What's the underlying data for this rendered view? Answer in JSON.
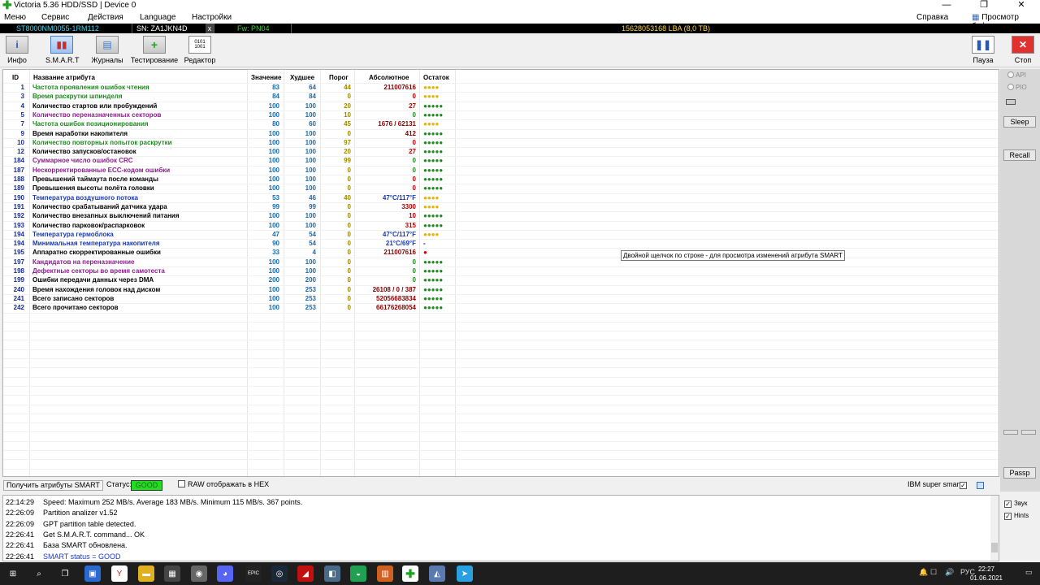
{
  "window": {
    "title": "Victoria 5.36 HDD/SSD | Device 0",
    "min": "—",
    "max": "❐",
    "close": "✕"
  },
  "menu": {
    "items": [
      "Меню",
      "Сервис",
      "Действия",
      "Language",
      "Настройки"
    ],
    "help": "Справка",
    "buffer": "Просмотр буфера"
  },
  "device": {
    "model": "ST8000NM0055-1RM112",
    "serial": "SN: ZA1JKN4D",
    "close": "x",
    "firmware": "Fw: PN04",
    "lba": "15628053168 LBA (8,0 TB)"
  },
  "toolbar": {
    "info": "Инфо",
    "smart": "S.M.A.R.T",
    "logs": "Журналы",
    "test": "Тестирование",
    "editor": "Редактор",
    "pause": "Пауза",
    "stop": "Стоп"
  },
  "table": {
    "headers": {
      "id": "ID",
      "name": "Название атрибута",
      "value": "Значение",
      "worst": "Худшее",
      "threshold": "Порог",
      "raw": "Абсолютное",
      "remaining": "Остаток"
    },
    "rows": [
      {
        "id": "1",
        "name": "Частота проявления ошибок чтения",
        "value": "83",
        "worst": "64",
        "thr": "44",
        "raw": "211007616",
        "rem": "●●●●",
        "nc": "#1f8a1f",
        "rc": "#8b0000",
        "dc": "#e8b000"
      },
      {
        "id": "3",
        "name": "Время раскрутки шпинделя",
        "value": "84",
        "worst": "84",
        "thr": "0",
        "raw": "0",
        "rem": "●●●●",
        "nc": "#1f8a1f",
        "rc": "#c00000",
        "dc": "#e8b000"
      },
      {
        "id": "4",
        "name": "Количество стартов или пробуждений",
        "value": "100",
        "worst": "100",
        "thr": "20",
        "raw": "27",
        "rem": "●●●●●",
        "nc": "#000000",
        "rc": "#c00000",
        "dc": "#1f8a1f"
      },
      {
        "id": "5",
        "name": "Количество переназначенных секторов",
        "value": "100",
        "worst": "100",
        "thr": "10",
        "raw": "0",
        "rem": "●●●●●",
        "nc": "#8a1f8a",
        "rc": "#1f8a1f",
        "dc": "#1f8a1f"
      },
      {
        "id": "7",
        "name": "Частота ошибок позиционирования",
        "value": "80",
        "worst": "60",
        "thr": "45",
        "raw": "1676 / 62131",
        "rem": "●●●●",
        "nc": "#1f8a1f",
        "rc": "#8b0000",
        "dc": "#e8b000"
      },
      {
        "id": "9",
        "name": "Время наработки накопителя",
        "value": "100",
        "worst": "100",
        "thr": "0",
        "raw": "412",
        "rem": "●●●●●",
        "nc": "#000000",
        "rc": "#8b0000",
        "dc": "#1f8a1f"
      },
      {
        "id": "10",
        "name": "Количество повторных попыток раскрутки",
        "value": "100",
        "worst": "100",
        "thr": "97",
        "raw": "0",
        "rem": "●●●●●",
        "nc": "#1f8a1f",
        "rc": "#c00000",
        "dc": "#1f8a1f"
      },
      {
        "id": "12",
        "name": "Количество запусков/остановок",
        "value": "100",
        "worst": "100",
        "thr": "20",
        "raw": "27",
        "rem": "●●●●●",
        "nc": "#000000",
        "rc": "#c00000",
        "dc": "#1f8a1f"
      },
      {
        "id": "184",
        "name": "Суммарное число ошибок CRC",
        "value": "100",
        "worst": "100",
        "thr": "99",
        "raw": "0",
        "rem": "●●●●●",
        "nc": "#8a1f8a",
        "rc": "#1f8a1f",
        "dc": "#1f8a1f"
      },
      {
        "id": "187",
        "name": "Нескорректированные ECC-кодом ошибки",
        "value": "100",
        "worst": "100",
        "thr": "0",
        "raw": "0",
        "rem": "●●●●●",
        "nc": "#8a1f8a",
        "rc": "#1f8a1f",
        "dc": "#1f8a1f"
      },
      {
        "id": "188",
        "name": "Превышений таймаута после команды",
        "value": "100",
        "worst": "100",
        "thr": "0",
        "raw": "0",
        "rem": "●●●●●",
        "nc": "#000000",
        "rc": "#c00000",
        "dc": "#1f8a1f"
      },
      {
        "id": "189",
        "name": "Превышения высоты полёта головки",
        "value": "100",
        "worst": "100",
        "thr": "0",
        "raw": "0",
        "rem": "●●●●●",
        "nc": "#000000",
        "rc": "#c00000",
        "dc": "#1f8a1f"
      },
      {
        "id": "190",
        "name": "Температура воздушного потока",
        "value": "53",
        "worst": "46",
        "thr": "40",
        "raw": "47°C/117°F",
        "rem": "●●●●",
        "nc": "#1a3ab0",
        "rc": "#1a3ab0",
        "dc": "#e8b000"
      },
      {
        "id": "191",
        "name": "Количество срабатываний датчика удара",
        "value": "99",
        "worst": "99",
        "thr": "0",
        "raw": "3300",
        "rem": "●●●●",
        "nc": "#000000",
        "rc": "#c00000",
        "dc": "#e8b000"
      },
      {
        "id": "192",
        "name": "Количество внезапных выключений питания",
        "value": "100",
        "worst": "100",
        "thr": "0",
        "raw": "10",
        "rem": "●●●●●",
        "nc": "#000000",
        "rc": "#c00000",
        "dc": "#1f8a1f"
      },
      {
        "id": "193",
        "name": "Количество парковок/распарковок",
        "value": "100",
        "worst": "100",
        "thr": "0",
        "raw": "315",
        "rem": "●●●●●",
        "nc": "#000000",
        "rc": "#c00000",
        "dc": "#1f8a1f"
      },
      {
        "id": "194",
        "name": "Температура гермоблока",
        "value": "47",
        "worst": "54",
        "thr": "0",
        "raw": "47°C/117°F",
        "rem": "●●●●",
        "nc": "#1a3ab0",
        "rc": "#1a3ab0",
        "dc": "#e8b000"
      },
      {
        "id": "194",
        "name": "Минимальная температура накопителя",
        "value": "90",
        "worst": "54",
        "thr": "0",
        "raw": "21°C/69°F",
        "rem": "-",
        "nc": "#1a3ab0",
        "rc": "#1a3ab0",
        "dc": "#000000"
      },
      {
        "id": "195",
        "name": "Аппаратно скорректированные ошибки",
        "value": "33",
        "worst": "4",
        "thr": "0",
        "raw": "211007616",
        "rem": "●",
        "nc": "#000000",
        "rc": "#8b0000",
        "dc": "#d00000"
      },
      {
        "id": "197",
        "name": "Кандидатов на переназначение",
        "value": "100",
        "worst": "100",
        "thr": "0",
        "raw": "0",
        "rem": "●●●●●",
        "nc": "#8a1f8a",
        "rc": "#1f8a1f",
        "dc": "#1f8a1f"
      },
      {
        "id": "198",
        "name": "Дефектные секторы во время самотеста",
        "value": "100",
        "worst": "100",
        "thr": "0",
        "raw": "0",
        "rem": "●●●●●",
        "nc": "#8a1f8a",
        "rc": "#1f8a1f",
        "dc": "#1f8a1f"
      },
      {
        "id": "199",
        "name": "Ошибки передачи данных через DMA",
        "value": "200",
        "worst": "200",
        "thr": "0",
        "raw": "0",
        "rem": "●●●●●",
        "nc": "#000000",
        "rc": "#1f8a1f",
        "dc": "#1f8a1f"
      },
      {
        "id": "240",
        "name": "Время нахождения головок над диском",
        "value": "100",
        "worst": "253",
        "thr": "0",
        "raw": "26108 / 0 / 387",
        "rem": "●●●●●",
        "nc": "#000000",
        "rc": "#8b0000",
        "dc": "#1f8a1f"
      },
      {
        "id": "241",
        "name": "Всего записано секторов",
        "value": "100",
        "worst": "253",
        "thr": "0",
        "raw": "52056683834",
        "rem": "●●●●●",
        "nc": "#000000",
        "rc": "#8b0000",
        "dc": "#1f8a1f"
      },
      {
        "id": "242",
        "name": "Всего прочитано секторов",
        "value": "100",
        "worst": "253",
        "thr": "0",
        "raw": "66176268054",
        "rem": "●●●●●",
        "nc": "#000000",
        "rc": "#8b0000",
        "dc": "#1f8a1f"
      }
    ]
  },
  "tooltip": "Двойной щелчок по строке - для просмотра изменений атрибута SMART",
  "side": {
    "api": "API",
    "pio": "PIO",
    "sleep": "Sleep",
    "recall": "Recall",
    "passp": "Passp",
    "sound": "Звук",
    "hints": "Hints",
    "sound_checked": "✓",
    "hints_checked": "✓"
  },
  "status": {
    "get_smart": "Получить атрибуты SMART",
    "status_label": "Статус:",
    "status_value": "GOOD",
    "raw_hex": "RAW отображать в HEX",
    "ibm": "IBM super smart:",
    "ibm_checked": "✓"
  },
  "log": [
    {
      "time": "22:14:29",
      "text": "Speed: Maximum 252 MB/s. Average 183 MB/s. Minimum 115 MB/s. 367 points.",
      "color": "#000000"
    },
    {
      "time": "22:26:09",
      "text": "Partition analizer v1.52",
      "color": "#000000"
    },
    {
      "time": "22:26:09",
      "text": "GPT partition table detected.",
      "color": "#000000"
    },
    {
      "time": "22:26:41",
      "text": "Get S.M.A.R.T. command... OK",
      "color": "#000000"
    },
    {
      "time": "22:26:41",
      "text": "База SMART обновлена.",
      "color": "#000000"
    },
    {
      "time": "22:26:41",
      "text": "SMART status = GOOD",
      "color": "#1a3ad0"
    }
  ],
  "taskbar": {
    "tray": "РУС",
    "time": "22:27",
    "date": "01.06.2021"
  }
}
